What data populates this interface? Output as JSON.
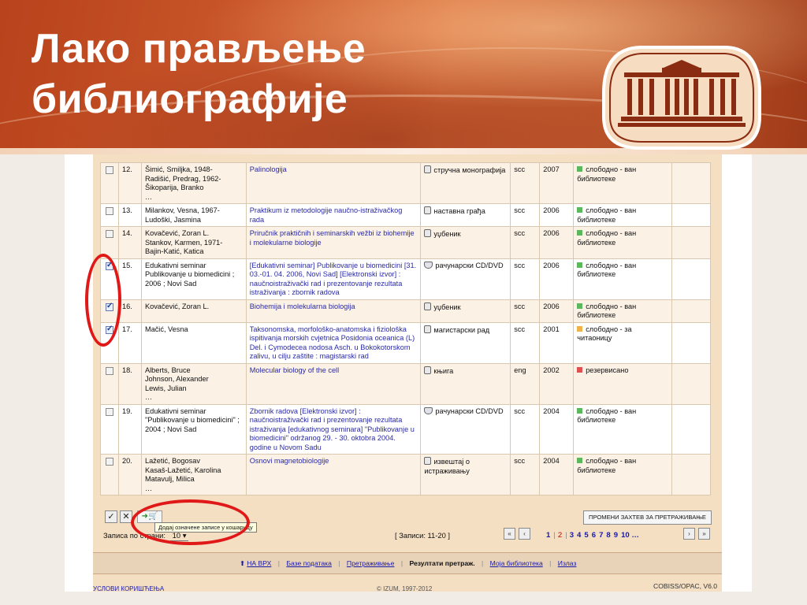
{
  "slide": {
    "title_line1": "Лако прављење",
    "title_line2": "библиографије"
  },
  "colors": {
    "header_orange": "#c9552a",
    "link_blue": "#2a2aa8",
    "annotation_red": "#e01818",
    "status_green": "#5cb85c",
    "status_orange": "#f0b24a",
    "status_red": "#e05050"
  },
  "results": [
    {
      "checked": false,
      "no": "12.",
      "author": "Šimić, Smiljka, 1948-\nRadišić, Predrag, 1962-\nŠikoparija, Branko\n…",
      "title": "Palinologija",
      "type": "стручна монографија",
      "type_icon": "book-icon",
      "lang": "scc",
      "year": "2007",
      "status": "слободно - ван библиотеке",
      "status_color": "green"
    },
    {
      "checked": false,
      "no": "13.",
      "author": "Milankov, Vesna, 1967-\nLudoški, Jasmina",
      "title": "Praktikum iz metodologije naučno-istraživačkog rada",
      "type": "наставна грађа",
      "type_icon": "book-icon",
      "lang": "scc",
      "year": "2006",
      "status": "слободно - ван библиотеке",
      "status_color": "green"
    },
    {
      "checked": false,
      "no": "14.",
      "author": "Kovačević, Zoran L.\nStankov, Karmen, 1971-\nBajin-Katić, Katica",
      "title": "Priručnik praktičnih i seminarskih vežbi iz biohemije i molekularne biologije",
      "type": "уџбеник",
      "type_icon": "book-icon",
      "lang": "scc",
      "year": "2006",
      "status": "слободно - ван библиотеке",
      "status_color": "green"
    },
    {
      "checked": true,
      "no": "15.",
      "author": "Edukativni seminar Publikovanje u biomedicini ; 2006 ; Novi Sad",
      "title": "[Edukativni seminar] Publikovanje u biomedicini [31. 03.-01. 04. 2006, Novi Sad] [Elektronski izvor] : naučnoistraživački rad i prezentovanje rezultata istraživanja : zbornik radova",
      "type": "рачунарски CD/DVD",
      "type_icon": "disc-icon",
      "lang": "scc",
      "year": "2006",
      "status": "слободно - ван библиотеке",
      "status_color": "green"
    },
    {
      "checked": true,
      "no": "16.",
      "author": "Kovačević, Zoran L.",
      "title": "Biohemija i molekularna biologija",
      "type": "уџбеник",
      "type_icon": "book-icon",
      "lang": "scc",
      "year": "2006",
      "status": "слободно - ван библиотеке",
      "status_color": "green"
    },
    {
      "checked": true,
      "no": "17.",
      "author": "Mačić, Vesna",
      "title": "Taksonomska, morfološko-anatomska i fiziološka ispitivanja morskih cvjetnica Posidonia oceanica (L) Del. i Cymodecea nodosa Asch. u Bokokotorskom zalivu, u cilju zaštite : magistarski rad",
      "type": "магистарски рад",
      "type_icon": "book-icon",
      "lang": "scc",
      "year": "2001",
      "status": "слободно - за читаоницу",
      "status_color": "orange"
    },
    {
      "checked": false,
      "no": "18.",
      "author": "Alberts, Bruce\nJohnson, Alexander\nLewis, Julian\n…",
      "title": "Molecular biology of the cell",
      "title_style": "purple",
      "type": "књига",
      "type_icon": "book-icon",
      "lang": "eng",
      "year": "2002",
      "status": "резервисано",
      "status_color": "red"
    },
    {
      "checked": false,
      "no": "19.",
      "author": "Edukativni seminar \"Publikovanje u biomedicini\" ; 2004 ; Novi Sad",
      "title": "Zbornik radova [Elektronski izvor] : naučnoistraživački rad i prezentovanje rezultata istraživanja [edukativnog seminara] \"Publikovanje u biomedicini\" održanog 29. - 30. oktobra 2004. godine u Novom Sadu",
      "type": "рачунарски CD/DVD",
      "type_icon": "disc-icon",
      "lang": "scc",
      "year": "2004",
      "status": "слободно - ван библиотеке",
      "status_color": "green"
    },
    {
      "checked": false,
      "no": "20.",
      "author": "Lažetić, Bogosav\nKasaš-Lažetić, Karolina\nMatavulj, Milica\n…",
      "title": "Osnovi magnetobiologije",
      "type": "извештај о истраживању",
      "type_icon": "book-icon",
      "lang": "scc",
      "year": "2004",
      "status": "слободно - ван библиотеке",
      "status_color": "green"
    }
  ],
  "controls": {
    "tooltip": "Додај означене записе у кошарицу",
    "change_query": "ПРОМЕНИ ЗАХТЕВ ЗА ПРЕТРАЖИВАЊЕ",
    "per_page_label": "Записа по страни:",
    "per_page_value": "10",
    "records": "[ Записи: 11-20 ]",
    "pages": [
      "1",
      "2",
      "3",
      "4",
      "5",
      "6",
      "7",
      "8",
      "9",
      "10 …"
    ],
    "current_page": "2"
  },
  "navbar": {
    "top": "НА ВРХ",
    "databases": "Базе података",
    "search": "Претраживање",
    "results": "Резултати претраж.",
    "my_library": "Моја библиотека",
    "exit": "Излаз"
  },
  "footer": {
    "terms": "УСЛОВИ КОРИШЋЕЊА",
    "copyright": "© IZUM, 1997-2012",
    "version": "COBISS/OPAC, V6.0"
  }
}
